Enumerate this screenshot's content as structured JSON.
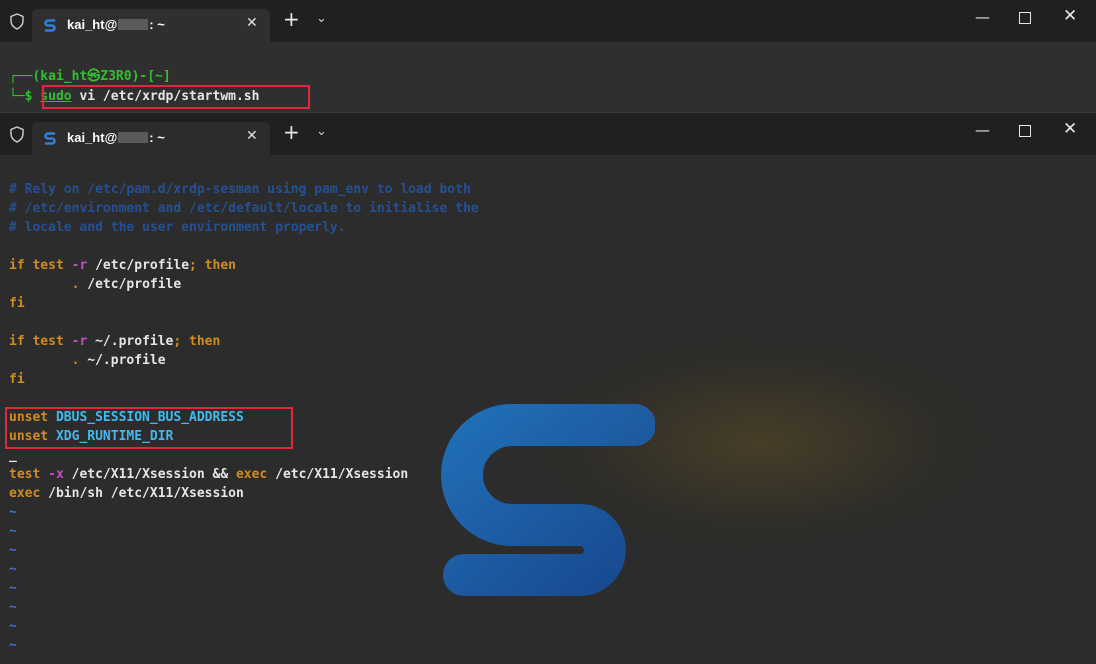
{
  "top_window": {
    "tab_title_prefix": "kai_ht@",
    "tab_title_suffix": ": ~",
    "prompt_line1": "┌──(kai_ht㉿Z3R0)-[~]",
    "prompt_char": "└─$ ",
    "command_sudo": "sudo",
    "command_rest": " vi /etc/xrdp/startwm.sh"
  },
  "bottom_window": {
    "tab_title_prefix": "kai_ht@",
    "tab_title_suffix": ": ~",
    "comment1": "# Rely on /etc/pam.d/xrdp-sesman using pam_env to load both",
    "comment2": "# /etc/environment and /etc/default/locale to initialise the",
    "comment3": "# locale and the user environment properly.",
    "if1_kw": "if test",
    "if1_flag": " -r",
    "if1_path": " /etc/profile",
    "if1_then": "; then",
    "dot1": "        .",
    "dot1_path": " /etc/profile",
    "fi": "fi",
    "if2_kw": "if test",
    "if2_flag": " -r",
    "if2_path": " ~/.profile",
    "if2_then": "; then",
    "dot2": "        .",
    "dot2_path": " ~/.profile",
    "unset1_kw": "unset",
    "unset1_var": " DBUS_SESSION_BUS_ADDRESS",
    "unset2_kw": "unset",
    "unset2_var": " XDG_RUNTIME_DIR",
    "cursor": "_",
    "test_kw": "test",
    "test_flag": " -x",
    "test_rest1": " /etc/X11/Xsession && ",
    "test_exec": "exec",
    "test_rest2": " /etc/X11/Xsession",
    "exec_kw": "exec",
    "exec_rest": " /bin/sh /etc/X11/Xsession",
    "tilde": "~"
  },
  "icons": {
    "shield": "shield-icon",
    "tab_logo": "terminal-s-logo-icon",
    "close_tab": "close-icon",
    "new_tab": "plus-icon",
    "dropdown": "chevron-down-icon",
    "minimize": "minimize-icon",
    "maximize": "maximize-icon",
    "close_window": "close-window-icon"
  },
  "glyphs": {
    "close": "✕",
    "plus": "+",
    "chevron": "⌄",
    "minimize": "—",
    "close_window": "✕"
  },
  "colors": {
    "comment": "#1f6fe8",
    "keyword": "#d28b1e",
    "variable": "#45b8f0",
    "highlight_box": "#e0283a",
    "prompt": "#2ec12e"
  }
}
